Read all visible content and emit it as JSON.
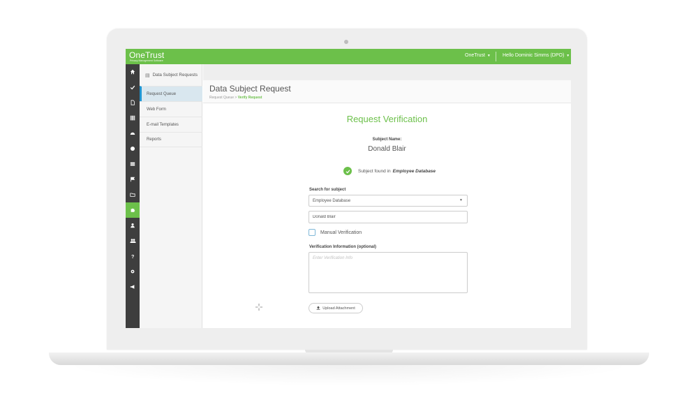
{
  "app": {
    "logo": "OneTrust",
    "logo_sub": "Privacy Management Software",
    "top_menu": "OneTrust",
    "user_menu": "Hello Dominic Simms (DPO)",
    "accent": "#6cc04a",
    "sidebar_dark": "#3e3e3e",
    "active_blue": "#1f96d3"
  },
  "iconbar": {
    "icons": [
      "home-icon",
      "check-icon",
      "document-icon",
      "grid-icon",
      "dashboard-icon",
      "globe-icon",
      "server-icon",
      "flag-icon",
      "folder-icon",
      "puzzle-icon",
      "user-icon",
      "users-icon",
      "help-icon",
      "gear-icon",
      "megaphone-icon"
    ],
    "active_index": 9
  },
  "subnav": {
    "header": "Data Subject Requests",
    "items": [
      "Request Queue",
      "Web Form",
      "E-mail Templates",
      "Reports"
    ],
    "active_index": 0
  },
  "page": {
    "title": "Data Subject Request",
    "breadcrumb_parent": "Request Queue",
    "breadcrumb_sep": ">",
    "breadcrumb_current": "Verify Request"
  },
  "verification": {
    "title": "Request Verification",
    "subject_label": "Subject Name:",
    "subject_name": "Donald Blair",
    "found_text": "Subject found in",
    "found_db": "Employee Database",
    "search_label": "Search for subject",
    "search_select": "Employee Database",
    "search_input": "Donald Blair",
    "manual_label": "Manual Verification",
    "info_label": "Verification Information (optional)",
    "info_placeholder": "Enter Verification Info",
    "upload_label": "Upload Attachment"
  }
}
